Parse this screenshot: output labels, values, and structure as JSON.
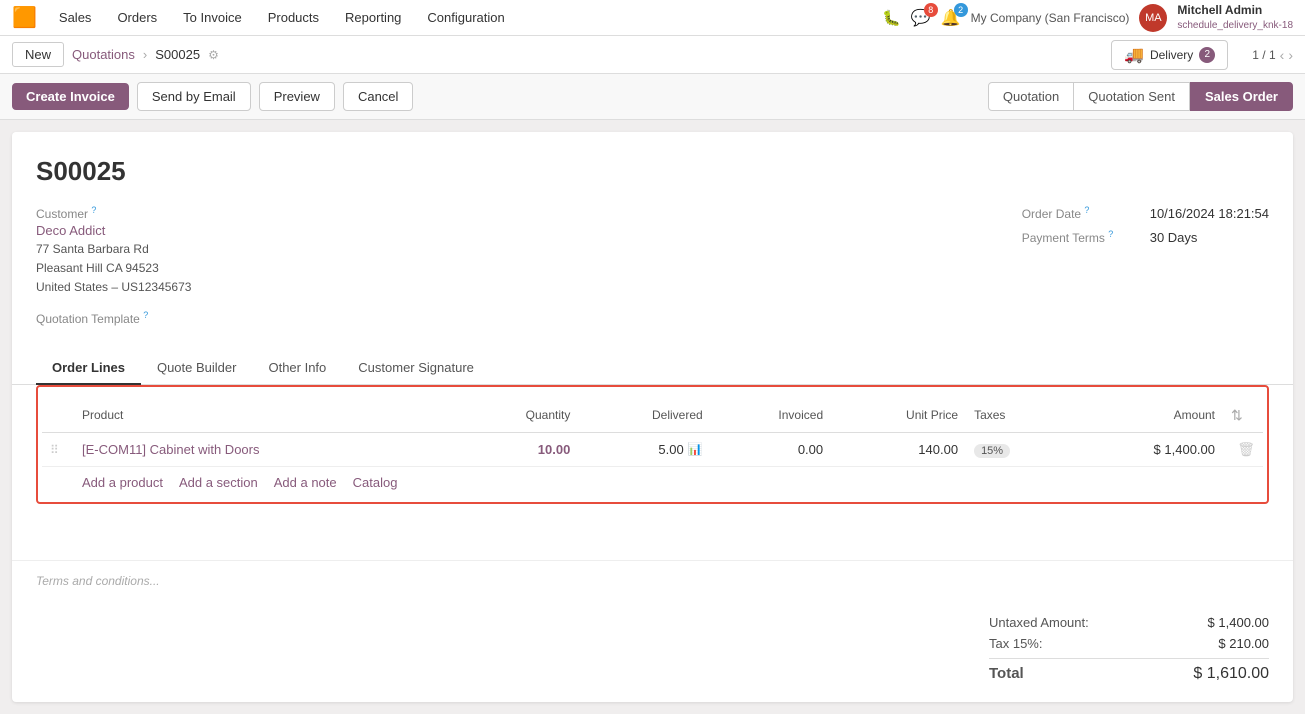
{
  "topnav": {
    "logo": "🟧",
    "items": [
      "Sales",
      "Orders",
      "To Invoice",
      "Products",
      "Reporting",
      "Configuration"
    ],
    "notifications": [
      {
        "icon": "🐞",
        "badge": null
      },
      {
        "icon": "💬",
        "badge": "8",
        "badge_type": "red"
      },
      {
        "icon": "🔔",
        "badge": "2",
        "badge_type": "blue"
      }
    ],
    "company": "My Company (San Francisco)",
    "user": {
      "name": "Mitchell Admin",
      "schedule": "schedule_delivery_knk-18"
    }
  },
  "breadcrumb": {
    "new_label": "New",
    "parent": "Quotations",
    "current": "S00025",
    "gear": "⚙"
  },
  "delivery": {
    "label": "Delivery",
    "count": "2"
  },
  "pagination": {
    "current": "1 / 1"
  },
  "actions": {
    "create_invoice": "Create Invoice",
    "send_by_email": "Send by Email",
    "preview": "Preview",
    "cancel": "Cancel"
  },
  "status_buttons": {
    "quotation": "Quotation",
    "quotation_sent": "Quotation Sent",
    "sales_order": "Sales Order"
  },
  "order": {
    "number": "S00025",
    "customer_label": "Customer",
    "customer_name": "Deco Addict",
    "address_line1": "77 Santa Barbara Rd",
    "address_line2": "Pleasant Hill CA 94523",
    "address_line3": "United States – US12345673",
    "quotation_template_label": "Quotation Template",
    "order_date_label": "Order Date",
    "order_date_value": "10/16/2024 18:21:54",
    "payment_terms_label": "Payment Terms",
    "payment_terms_value": "30 Days"
  },
  "tabs": [
    {
      "label": "Order Lines",
      "active": true
    },
    {
      "label": "Quote Builder",
      "active": false
    },
    {
      "label": "Other Info",
      "active": false
    },
    {
      "label": "Customer Signature",
      "active": false
    }
  ],
  "table": {
    "columns": [
      "Product",
      "Quantity",
      "Delivered",
      "Invoiced",
      "Unit Price",
      "Taxes",
      "Amount",
      ""
    ],
    "rows": [
      {
        "product": "[E-COM11] Cabinet with Doors",
        "quantity": "10.00",
        "delivered": "5.00",
        "invoiced": "0.00",
        "unit_price": "140.00",
        "tax": "15%",
        "amount": "$ 1,400.00"
      }
    ],
    "add_product": "Add a product",
    "add_section": "Add a section",
    "add_note": "Add a note",
    "catalog": "Catalog"
  },
  "terms": {
    "placeholder": "Terms and conditions..."
  },
  "totals": {
    "untaxed_label": "Untaxed Amount:",
    "untaxed_value": "$ 1,400.00",
    "tax_label": "Tax 15%:",
    "tax_value": "$ 210.00",
    "total_label": "Total",
    "total_value": "$ 1,610.00"
  }
}
